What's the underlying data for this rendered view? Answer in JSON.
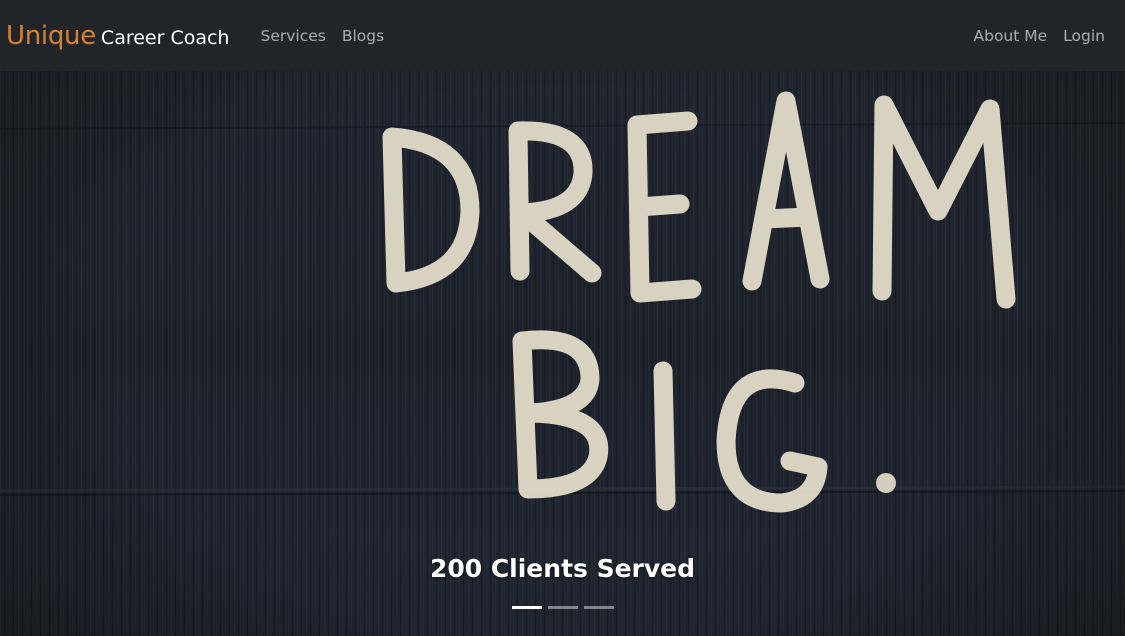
{
  "navbar": {
    "brand": {
      "accent": "Unique",
      "rest": "Career Coach",
      "accent_color": "#d9822b"
    },
    "left_links": [
      {
        "label": "Services"
      },
      {
        "label": "Blogs"
      }
    ],
    "right_links": [
      {
        "label": "About Me"
      },
      {
        "label": "Login"
      }
    ]
  },
  "carousel": {
    "image_text": [
      "DREAM",
      "BIG."
    ],
    "caption": "200 Clients Served",
    "slides_total": 3,
    "active_slide": 1
  }
}
